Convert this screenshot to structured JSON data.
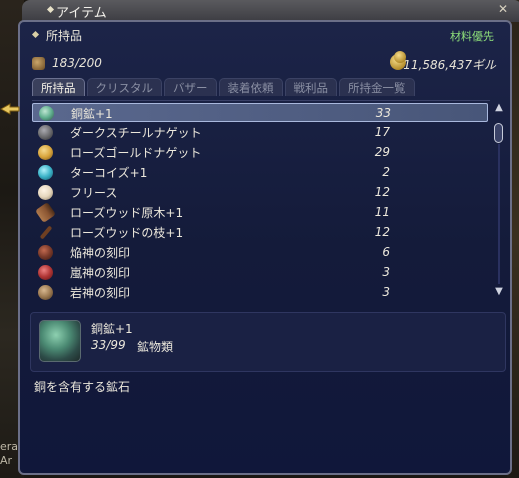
{
  "window": {
    "title": "アイテム",
    "section_label": "所持品",
    "sort_label": "材料優先",
    "item_count": "183/200",
    "gil": "11,586,437ギル"
  },
  "tabs": [
    {
      "label": "所持品",
      "active": true
    },
    {
      "label": "クリスタル",
      "active": false
    },
    {
      "label": "バザー",
      "active": false
    },
    {
      "label": "装着依頼",
      "active": false
    },
    {
      "label": "戦利品",
      "active": false
    },
    {
      "label": "所持金一覧",
      "active": false
    }
  ],
  "items": [
    {
      "name": "銅鉱+1",
      "qty": "33",
      "icon": "copper-ore-icon",
      "color": "#5fae8e",
      "selected": true
    },
    {
      "name": "ダークスチールナゲット",
      "qty": "17",
      "icon": "darksteel-nugget-icon",
      "color": "#6d6d70"
    },
    {
      "name": "ローズゴールドナゲット",
      "qty": "29",
      "icon": "rose-gold-nugget-icon",
      "color": "#d9a63e"
    },
    {
      "name": "ターコイズ+1",
      "qty": "2",
      "icon": "turquoise-icon",
      "color": "#3bb3c8"
    },
    {
      "name": "フリース",
      "qty": "12",
      "icon": "fleece-icon",
      "color": "#e6d7be"
    },
    {
      "name": "ローズウッド原木+1",
      "qty": "11",
      "icon": "rosewood-log-icon",
      "color": "#8a5532"
    },
    {
      "name": "ローズウッドの枝+1",
      "qty": "12",
      "icon": "rosewood-branch-icon",
      "color": "#6e3f22"
    },
    {
      "name": "焔神の刻印",
      "qty": "6",
      "icon": "fire-seal-icon",
      "color": "#7a3a2a"
    },
    {
      "name": "嵐神の刻印",
      "qty": "3",
      "icon": "storm-seal-icon",
      "color": "#b03535"
    },
    {
      "name": "岩神の刻印",
      "qty": "3",
      "icon": "rock-seal-icon",
      "color": "#9c7a52"
    }
  ],
  "detail": {
    "name": "銅鉱+1",
    "count": "33/99",
    "type": "鉱物類",
    "description": "銅を含有する鉱石"
  },
  "background": {
    "line1": "era",
    "line2": "Ar"
  }
}
